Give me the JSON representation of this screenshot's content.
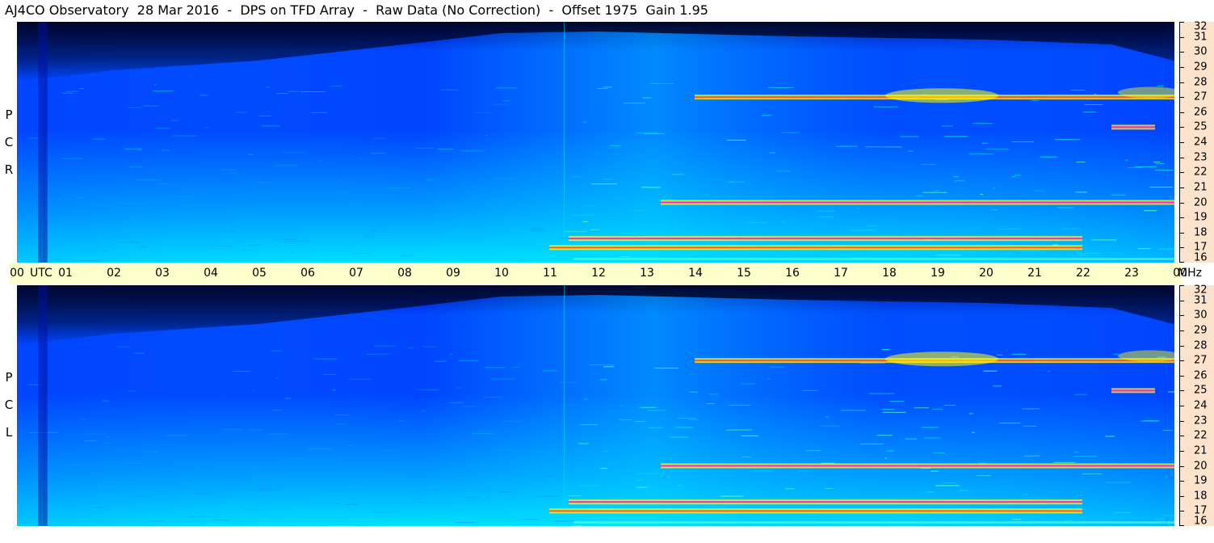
{
  "title": "AJ4CO Observatory  28 Mar 2016  -  DPS on TFD Array  -  Raw Data (No Correction)  -  Offset 1975  Gain 1.95",
  "time_axis": {
    "unit_label": "UTC",
    "ticks": [
      "00",
      "01",
      "02",
      "03",
      "04",
      "05",
      "06",
      "07",
      "08",
      "09",
      "10",
      "11",
      "12",
      "13",
      "14",
      "15",
      "16",
      "17",
      "18",
      "19",
      "20",
      "21",
      "22",
      "23",
      "00"
    ],
    "freq_unit": "MHz"
  },
  "panels": [
    {
      "name": "rcp",
      "letters": [
        "P",
        "C",
        "R"
      ]
    },
    {
      "name": "lcp",
      "letters": [
        "P",
        "C",
        "L"
      ]
    }
  ],
  "chart_data": [
    {
      "type": "heatmap",
      "title": "AJ4CO Observatory  28 Mar 2016  -  DPS on TFD Array  -  Raw Data (No Correction)  -  Offset 1975  Gain 1.95",
      "panel": "RCP",
      "x_label": "UTC",
      "x_range": [
        0,
        24
      ],
      "x_ticks": [
        "00",
        "01",
        "02",
        "03",
        "04",
        "05",
        "06",
        "07",
        "08",
        "09",
        "10",
        "11",
        "12",
        "13",
        "14",
        "15",
        "16",
        "17",
        "18",
        "19",
        "20",
        "21",
        "22",
        "23",
        "00"
      ],
      "y_label": "MHz",
      "y_range": [
        16,
        32
      ],
      "y_ticks": [
        16,
        17,
        18,
        19,
        20,
        21,
        22,
        23,
        24,
        25,
        26,
        27,
        28,
        29,
        30,
        31,
        32
      ],
      "colormap": [
        "#000830",
        "#0010a0",
        "#0044ff",
        "#00a0ff",
        "#00e0ff",
        "#60ffb0",
        "#ffff00",
        "#ff4040",
        "#ff00ff"
      ],
      "bands": [
        {
          "freq_mhz": 17.6,
          "start_utc": 11.4,
          "end_utc": 22.0
        },
        {
          "freq_mhz": 17.0,
          "start_utc": 11.0,
          "end_utc": 22.0
        },
        {
          "freq_mhz": 20.0,
          "start_utc": 13.3,
          "end_utc": 23.9
        },
        {
          "freq_mhz": 27.0,
          "start_utc": 14.0,
          "end_utc": 24.0
        },
        {
          "freq_mhz": 25.0,
          "start_utc": 22.6,
          "end_utc": 23.5
        }
      ]
    },
    {
      "type": "heatmap",
      "panel": "LCP",
      "x_label": "UTC",
      "x_range": [
        0,
        24
      ],
      "y_label": "MHz",
      "y_range": [
        16,
        32
      ],
      "y_ticks": [
        16,
        17,
        18,
        19,
        20,
        21,
        22,
        23,
        24,
        25,
        26,
        27,
        28,
        29,
        30,
        31,
        32
      ],
      "colormap": [
        "#000830",
        "#0010a0",
        "#0044ff",
        "#00a0ff",
        "#00e0ff",
        "#60ffb0",
        "#ffff00",
        "#ff4040",
        "#ff00ff"
      ],
      "bands": [
        {
          "freq_mhz": 17.6,
          "start_utc": 11.4,
          "end_utc": 22.0
        },
        {
          "freq_mhz": 17.0,
          "start_utc": 11.0,
          "end_utc": 22.0
        },
        {
          "freq_mhz": 20.0,
          "start_utc": 13.3,
          "end_utc": 23.9
        },
        {
          "freq_mhz": 27.0,
          "start_utc": 14.0,
          "end_utc": 24.0
        },
        {
          "freq_mhz": 25.0,
          "start_utc": 22.6,
          "end_utc": 23.5
        }
      ]
    }
  ]
}
